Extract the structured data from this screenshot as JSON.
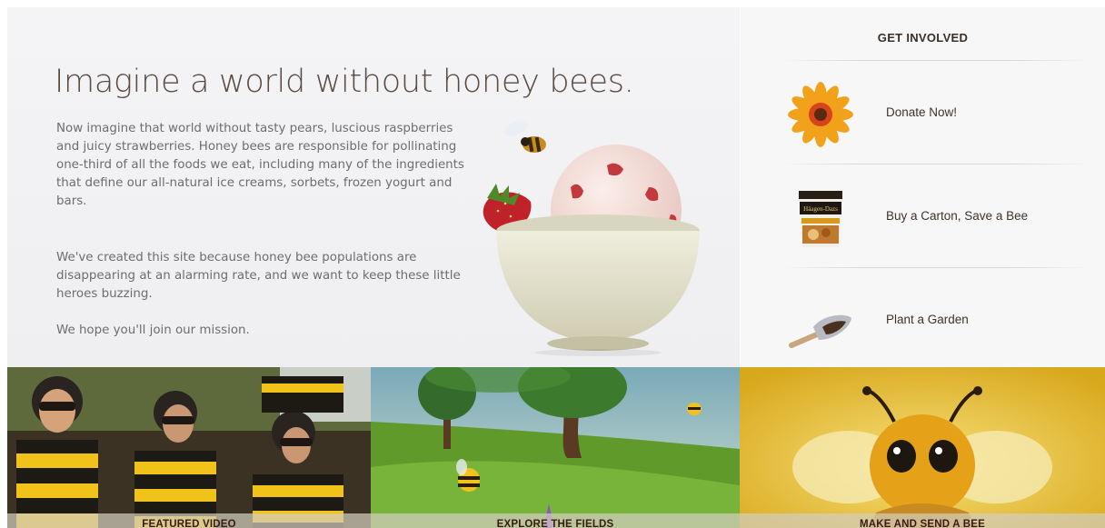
{
  "main": {
    "headline": "Imagine a world without honey bees.",
    "paragraph_1": "Now imagine that world without tasty pears, luscious raspberries and juicy strawberries. Honey bees are responsible for pollinating one-third of all the foods we eat, including many of the ingredients that define our all-natural ice creams, sorbets, frozen yogurt and bars.",
    "paragraph_2": "We've created this site because honey bee populations are disappearing at an alarming rate, and we want to keep these little heroes buzzing.",
    "paragraph_3": "We hope you'll join our mission."
  },
  "sidebar": {
    "title": "GET INVOLVED",
    "items": [
      {
        "label": "Donate Now!",
        "icon": "flower-icon"
      },
      {
        "label": "Buy a Carton, Save a Bee",
        "icon": "ice-cream-carton-icon",
        "carton_text": "Häagen-Dazs"
      },
      {
        "label": "Plant a Garden",
        "icon": "garden-trowel-icon"
      }
    ]
  },
  "tiles": [
    {
      "label": "FEATURED VIDEO",
      "image": "people-in-bee-costumes"
    },
    {
      "label": "EXPLORE THE FIELDS",
      "image": "animated-meadow-with-bees"
    },
    {
      "label": "MAKE AND SEND A BEE",
      "image": "cartoon-bee-character"
    }
  ],
  "colors": {
    "headline": "#5a4a42",
    "body_text": "#6d6d6d",
    "tile_label": "#3a1a14",
    "honey_yellow": "#f0c21a"
  }
}
